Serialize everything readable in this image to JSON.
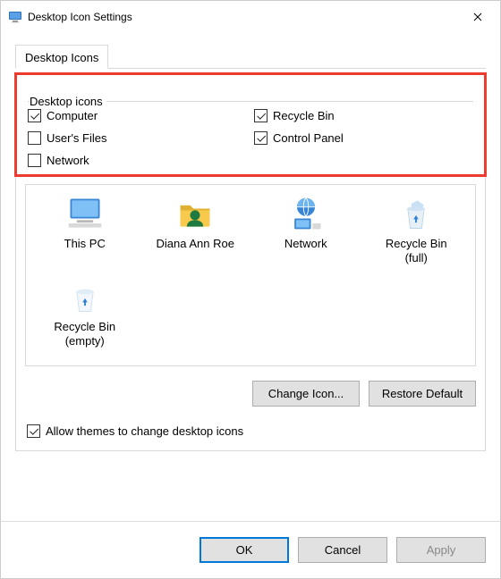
{
  "window": {
    "title": "Desktop Icon Settings"
  },
  "tabs": {
    "tab1_label": "Desktop Icons"
  },
  "groupbox": {
    "label": "Desktop icons",
    "items": {
      "computer": {
        "label": "Computer",
        "checked": true
      },
      "users_files": {
        "label": "User's Files",
        "checked": false
      },
      "network": {
        "label": "Network",
        "checked": false
      },
      "recycle_bin": {
        "label": "Recycle Bin",
        "checked": true
      },
      "control_panel": {
        "label": "Control Panel",
        "checked": true
      }
    }
  },
  "preview_icons": [
    {
      "name": "this-pc",
      "label": "This PC"
    },
    {
      "name": "user-folder",
      "label": "Diana Ann Roe"
    },
    {
      "name": "network",
      "label": "Network"
    },
    {
      "name": "recycle-bin-full",
      "label": "Recycle Bin\n(full)"
    },
    {
      "name": "recycle-bin-empty",
      "label": "Recycle Bin\n(empty)"
    }
  ],
  "buttons": {
    "change_icon": "Change Icon...",
    "restore_default": "Restore Default",
    "ok": "OK",
    "cancel": "Cancel",
    "apply": "Apply"
  },
  "allow_themes": {
    "label": "Allow themes to change desktop icons",
    "checked": true
  }
}
